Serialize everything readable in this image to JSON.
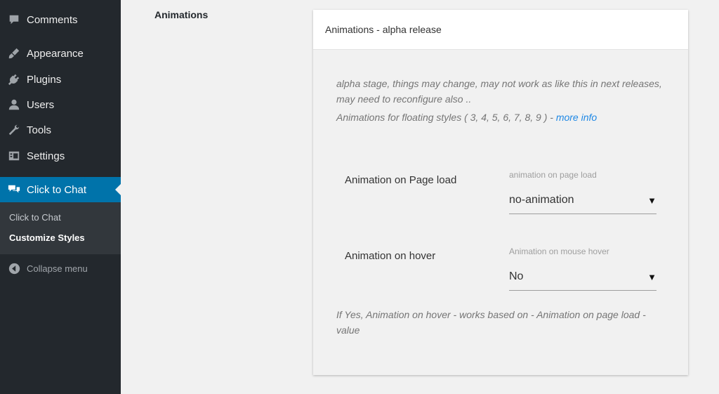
{
  "sidebar": {
    "items": [
      {
        "label": "Comments",
        "icon": "comments-icon"
      },
      {
        "label": "Appearance",
        "icon": "appearance-icon"
      },
      {
        "label": "Plugins",
        "icon": "plugins-icon"
      },
      {
        "label": "Users",
        "icon": "users-icon"
      },
      {
        "label": "Tools",
        "icon": "tools-icon"
      },
      {
        "label": "Settings",
        "icon": "settings-icon"
      },
      {
        "label": "Click to Chat",
        "icon": "chat-icon",
        "current": true
      }
    ],
    "submenu": [
      {
        "label": "Click to Chat"
      },
      {
        "label": "Customize Styles",
        "active": true
      }
    ],
    "collapse_label": "Collapse menu"
  },
  "main": {
    "section_label": "Animations",
    "card": {
      "title": "Animations - alpha release",
      "note_line1": "alpha stage, things may change, may not work as like this in next releases,",
      "note_line2": "may need to reconfigure also ..",
      "note_line3_prefix": "Animations for floating styles ( 3, 4, 5, 6, 7, 8, 9 ) - ",
      "note_line3_link": "more info",
      "page_load": {
        "label": "Animation on Page load",
        "field_label": "animation on page load",
        "value": "no-animation"
      },
      "hover": {
        "label": "Animation on hover",
        "field_label": "Animation on mouse hover",
        "value": "No"
      },
      "footer_note": "If Yes, Animation on hover - works based on - Animation on page load - value"
    }
  },
  "colors": {
    "sidebar_bg": "#23282d",
    "accent": "#0073aa",
    "link": "#1e88e5"
  }
}
